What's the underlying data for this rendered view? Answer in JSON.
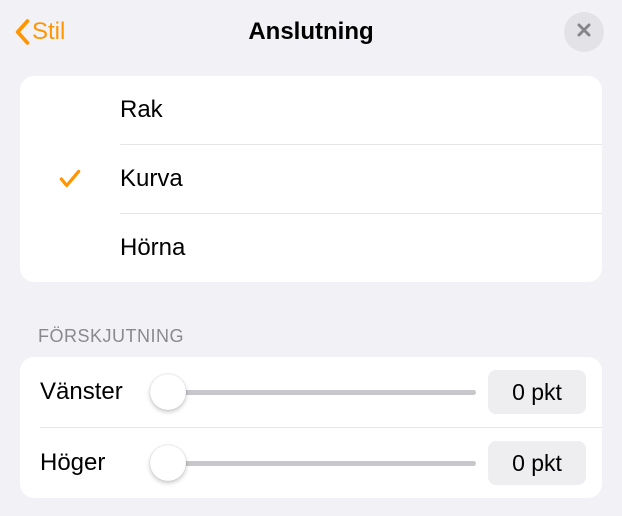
{
  "header": {
    "back_label": "Stil",
    "title": "Anslutning"
  },
  "connection_types": {
    "items": [
      {
        "label": "Rak",
        "selected": false
      },
      {
        "label": "Kurva",
        "selected": true
      },
      {
        "label": "Hörna",
        "selected": false
      }
    ]
  },
  "offset": {
    "section_title": "FÖRSKJUTNING",
    "rows": [
      {
        "label": "Vänster",
        "value_display": "0 pkt"
      },
      {
        "label": "Höger",
        "value_display": "0 pkt"
      }
    ]
  },
  "colors": {
    "accent": "#ff9500"
  }
}
